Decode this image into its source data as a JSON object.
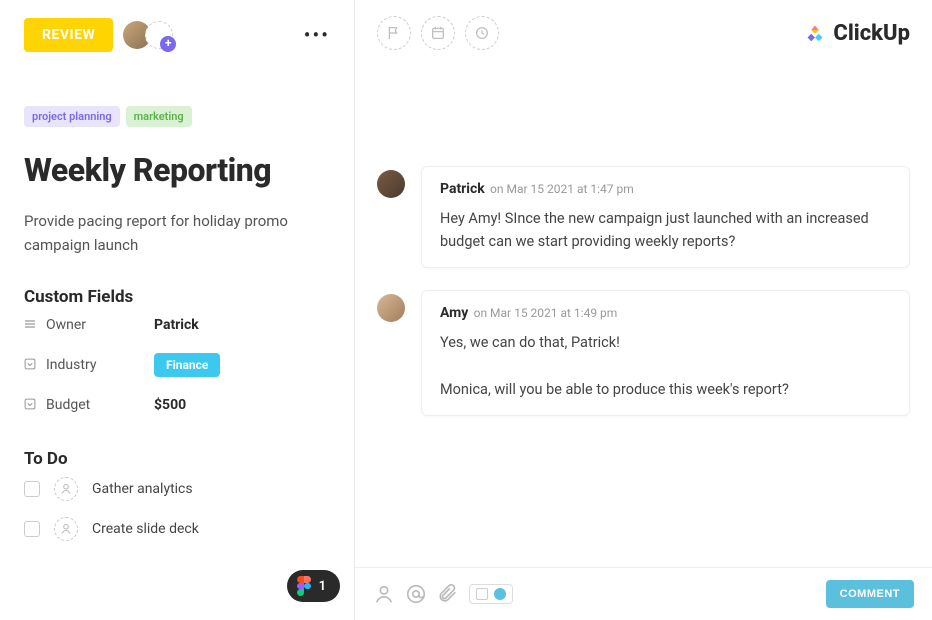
{
  "task": {
    "status": "REVIEW",
    "tags": [
      {
        "label": "project planning",
        "style": "purple"
      },
      {
        "label": "marketing",
        "style": "green"
      }
    ],
    "title": "Weekly Reporting",
    "description": "Provide pacing report for holiday promo campaign launch",
    "custom_fields_heading": "Custom Fields",
    "custom_fields": {
      "owner_label": "Owner",
      "owner_value": "Patrick",
      "industry_label": "Industry",
      "industry_value": "Finance",
      "budget_label": "Budget",
      "budget_value": "$500"
    },
    "todo_heading": "To Do",
    "todos": [
      {
        "label": "Gather analytics"
      },
      {
        "label": "Create slide deck"
      }
    ],
    "figma_count": "1"
  },
  "brand": {
    "name": "ClickUp"
  },
  "comments": [
    {
      "author": "Patrick",
      "time": "on Mar 15 2021 at 1:47 pm",
      "text": "Hey Amy! SInce the new campaign just launched with an increased budget can we start providing weekly reports?"
    },
    {
      "author": "Amy",
      "time": "on Mar 15 2021 at 1:49 pm",
      "text": "Yes, we can do that, Patrick!\n\nMonica, will you be able to produce this week's report?"
    }
  ],
  "footer": {
    "comment_button": "COMMENT"
  }
}
